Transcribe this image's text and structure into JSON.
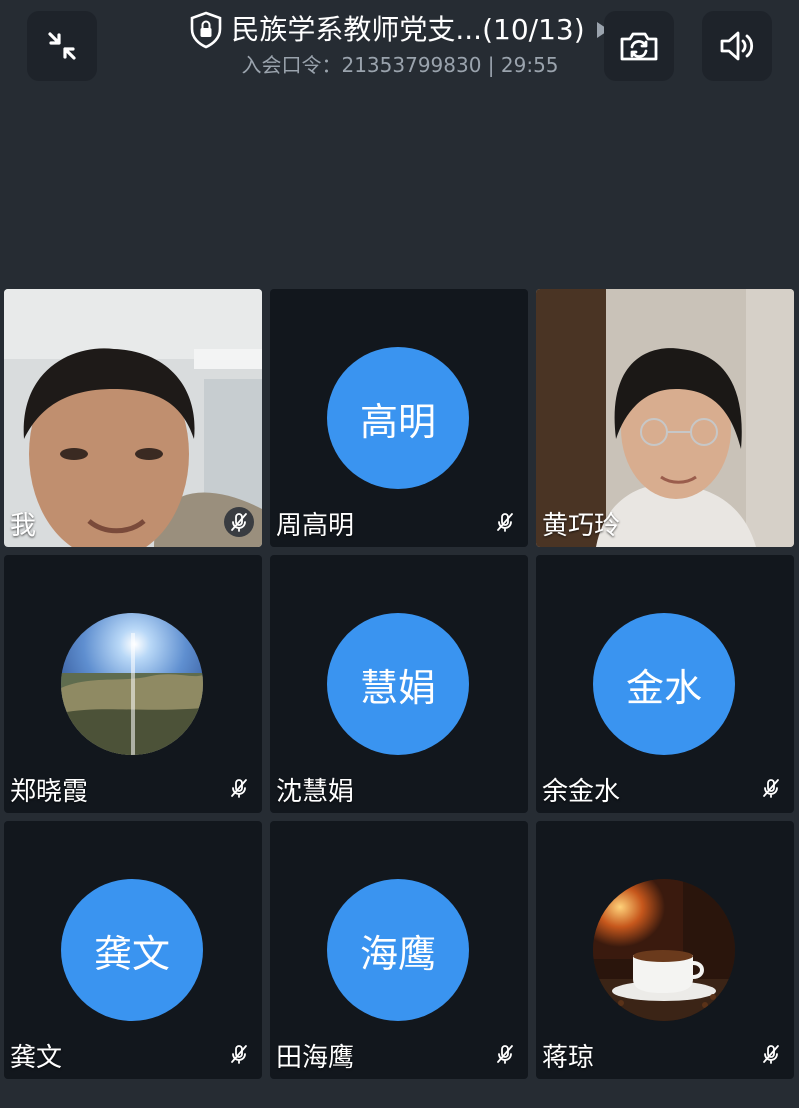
{
  "header": {
    "title": "民族学系教师党支...(10/13)",
    "subtitle": "入会口令：21353799830 | 29:55",
    "minimize_icon": "minimize-arrows-icon",
    "camera_switch_icon": "camera-switch-icon",
    "speaker_icon": "speaker-icon",
    "lock_icon": "shield-lock-icon",
    "more_icon": "play-triangle-icon"
  },
  "participants": [
    {
      "name": "我",
      "type": "video",
      "muted": true
    },
    {
      "name": "周高明",
      "type": "avatar",
      "avatar_text": "高明",
      "muted": true
    },
    {
      "name": "黄巧玲",
      "type": "video",
      "muted": false
    },
    {
      "name": "郑晓霞",
      "type": "image",
      "image": "sunlit-grass-landscape",
      "muted": true
    },
    {
      "name": "沈慧娟",
      "type": "avatar",
      "avatar_text": "慧娟",
      "muted": false
    },
    {
      "name": "余金水",
      "type": "avatar",
      "avatar_text": "金水",
      "muted": true
    },
    {
      "name": "龚文",
      "type": "avatar",
      "avatar_text": "龚文",
      "muted": true
    },
    {
      "name": "田海鹰",
      "type": "avatar",
      "avatar_text": "海鹰",
      "muted": true
    },
    {
      "name": "蒋琼",
      "type": "image",
      "image": "coffee-cup-fireplace",
      "muted": true
    }
  ],
  "colors": {
    "background": "#262c33",
    "tile": "#12171d",
    "avatar": "#3a94f0"
  }
}
